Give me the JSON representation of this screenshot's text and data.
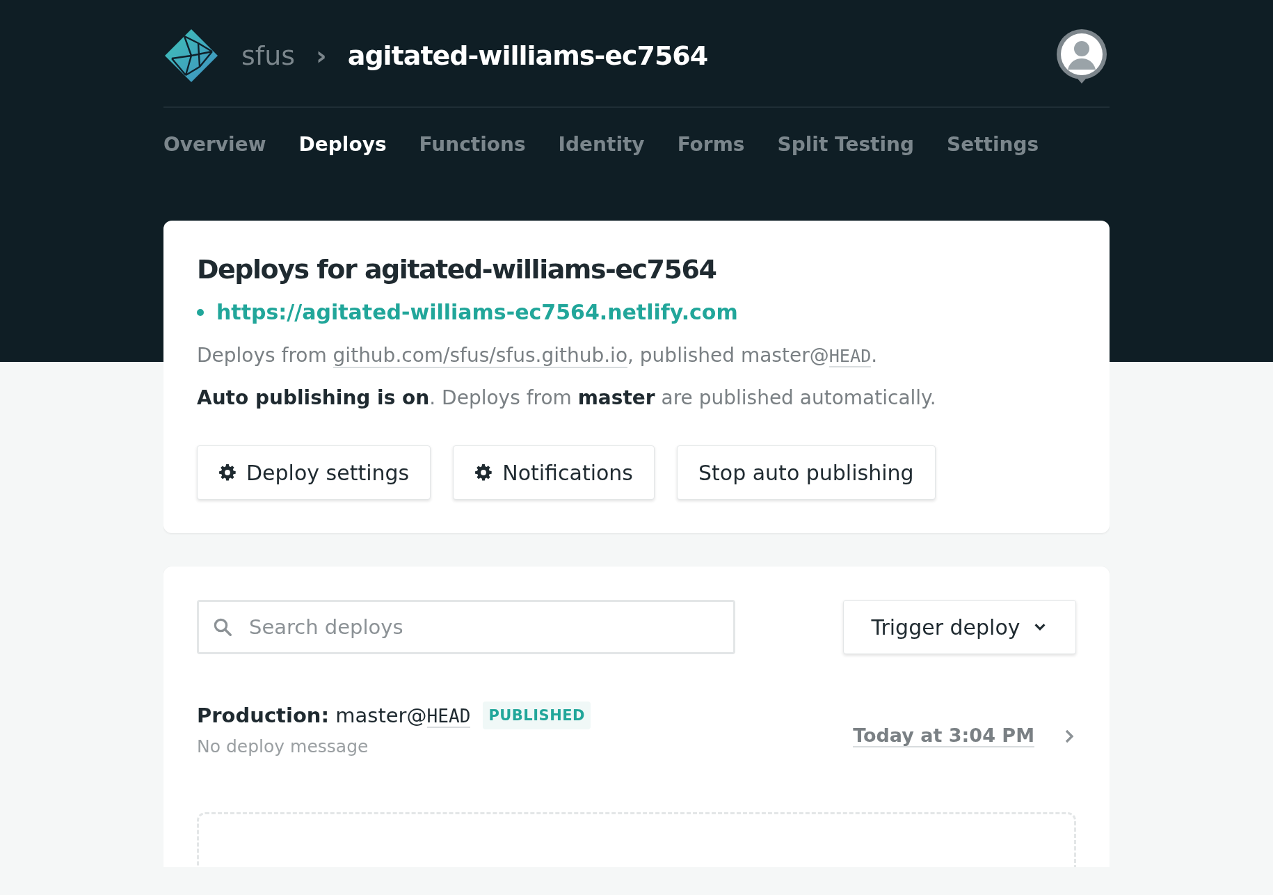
{
  "header": {
    "team": "sfus",
    "separator": "›",
    "site": "agitated-williams-ec7564"
  },
  "tabs": [
    {
      "label": "Overview",
      "selected": false
    },
    {
      "label": "Deploys",
      "selected": true
    },
    {
      "label": "Functions",
      "selected": false
    },
    {
      "label": "Identity",
      "selected": false
    },
    {
      "label": "Forms",
      "selected": false
    },
    {
      "label": "Split Testing",
      "selected": false
    },
    {
      "label": "Settings",
      "selected": false
    }
  ],
  "summary": {
    "title": "Deploys for agitated-williams-ec7564",
    "url": "https://agitated-williams-ec7564.netlify.com",
    "source": {
      "before": "Deploys from ",
      "repo": "github.com/sfus/sfus.github.io",
      "middle": ", published master@",
      "ref": "HEAD",
      "after": "."
    },
    "auto_publish": "**Auto publishing is on**. Deploys from **master** are published automatically.",
    "buttons": [
      {
        "label": "Deploy settings",
        "kind": "settings"
      },
      {
        "label": "Notifications",
        "kind": "settings"
      },
      {
        "label": "Stop auto publishing",
        "kind": "plain"
      }
    ]
  },
  "deploys_panel": {
    "search": {
      "placeholder": "Search deploys"
    },
    "trigger": {
      "label": "Trigger deploy"
    },
    "deploys": [
      {
        "context": "Production:",
        "branch": "master@",
        "ref": "HEAD",
        "status": "PUBLISHED",
        "message": "No deploy message",
        "time": "Today at 3:04 PM"
      }
    ]
  }
}
